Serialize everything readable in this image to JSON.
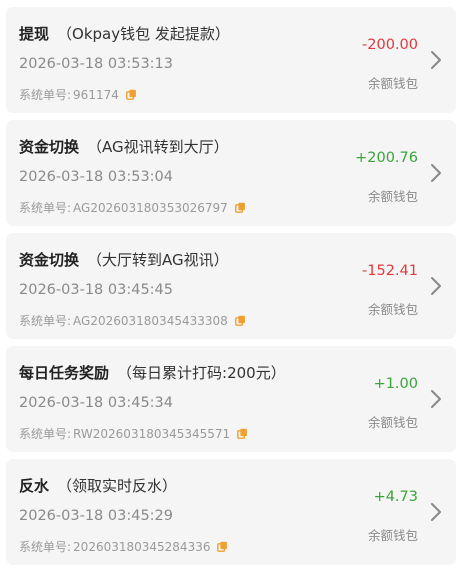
{
  "colors": {
    "negative": "#e0393e",
    "positive": "#3aa43a",
    "copy_icon": "#f0a030",
    "chevron": "#888888"
  },
  "records": [
    {
      "title": "提现",
      "subtitle": "（Okpay钱包 发起提款）",
      "time": "2026-03-18 03:53:13",
      "serial_label": "系统单号:",
      "serial_no": "961174",
      "amount": "-200.00",
      "direction": "negative",
      "wallet": "余额钱包"
    },
    {
      "title": "资金切换",
      "subtitle": "（AG视讯转到大厅）",
      "time": "2026-03-18 03:53:04",
      "serial_label": "系统单号:",
      "serial_no": "AG202603180353026797",
      "amount": "+200.76",
      "direction": "positive",
      "wallet": "余额钱包"
    },
    {
      "title": "资金切换",
      "subtitle": "（大厅转到AG视讯）",
      "time": "2026-03-18 03:45:45",
      "serial_label": "系统单号:",
      "serial_no": "AG202603180345433308",
      "amount": "-152.41",
      "direction": "negative",
      "wallet": "余额钱包"
    },
    {
      "title": "每日任务奖励",
      "subtitle": "（每日累计打码:200元）",
      "time": "2026-03-18 03:45:34",
      "serial_label": "系统单号:",
      "serial_no": "RW202603180345345571",
      "amount": "+1.00",
      "direction": "positive",
      "wallet": "余额钱包"
    },
    {
      "title": "反水",
      "subtitle": "（领取实时反水）",
      "time": "2026-03-18 03:45:29",
      "serial_label": "系统单号:",
      "serial_no": "202603180345284336",
      "amount": "+4.73",
      "direction": "positive",
      "wallet": "余额钱包"
    }
  ]
}
